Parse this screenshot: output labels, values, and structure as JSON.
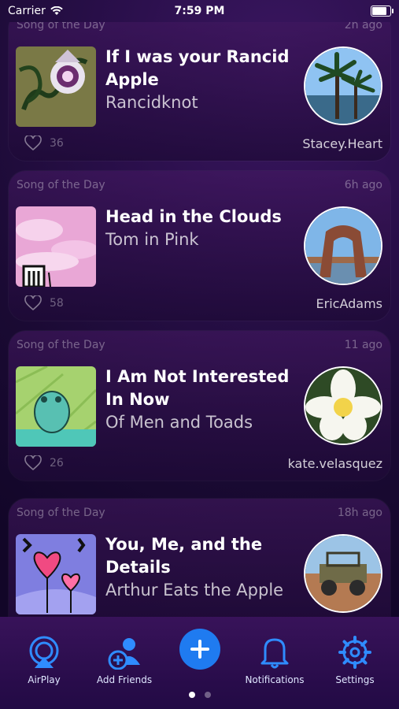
{
  "status": {
    "carrier": "Carrier",
    "time": "7:59 PM"
  },
  "feed": [
    {
      "kicker": "Song of the Day",
      "ago": "2h ago",
      "title": "If I was your Rancid Apple",
      "artist": "Rancidknot",
      "likes": "36",
      "user": "Stacey.Heart"
    },
    {
      "kicker": "Song of the Day",
      "ago": "6h ago",
      "title": "Head in the Clouds",
      "artist": "Tom in Pink",
      "likes": "58",
      "user": "EricAdams"
    },
    {
      "kicker": "Song of the Day",
      "ago": "11 ago",
      "title": "I Am Not Interested In Now",
      "artist": "Of Men and Toads",
      "likes": "26",
      "user": "kate.velasquez"
    },
    {
      "kicker": "Song of the Day",
      "ago": "18h ago",
      "title": "You, Me, and the Details",
      "artist": "Arthur Eats the Apple",
      "likes": "",
      "user": ""
    }
  ],
  "tabbar": {
    "airplay": "AirPlay",
    "add_friends": "Add Friends",
    "notifications": "Notifications",
    "settings": "Settings"
  },
  "colors": {
    "accent": "#1f7bf0",
    "tab_icon": "#2f8cff"
  }
}
